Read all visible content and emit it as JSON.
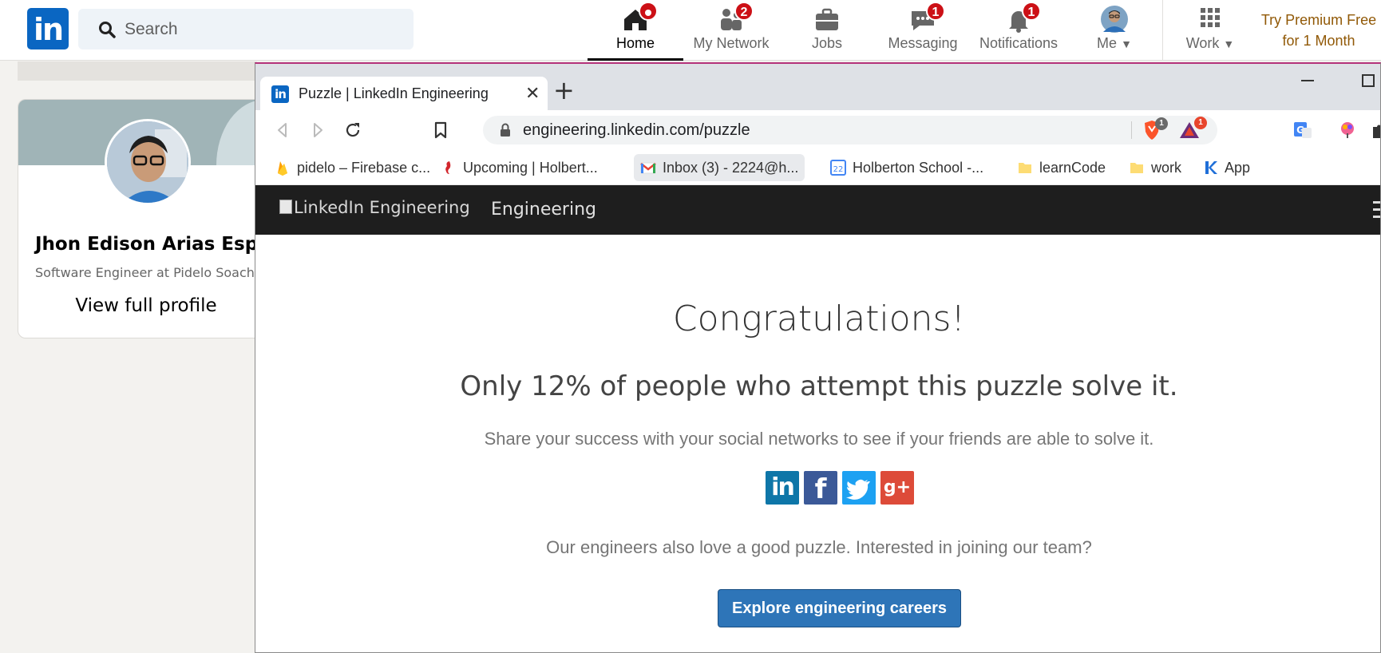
{
  "linkedin": {
    "logo_text": "in",
    "search_placeholder": "Search",
    "nav": [
      {
        "label": "Home",
        "badge": ""
      },
      {
        "label": "My Network",
        "badge": "2"
      },
      {
        "label": "Jobs",
        "badge": ""
      },
      {
        "label": "Messaging",
        "badge": "1"
      },
      {
        "label": "Notifications",
        "badge": "1"
      },
      {
        "label": "Me",
        "badge": ""
      },
      {
        "label": "Work",
        "badge": ""
      }
    ],
    "premium_line1": "Try Premium Free",
    "premium_line2": "for 1 Month",
    "brand_color": "#0a66c2",
    "badge_color": "#cc1016"
  },
  "profile": {
    "name": "Jhon Edison Arias Esparza",
    "headline": "Software Engineer at Pidelo Soacha",
    "link": "View full profile"
  },
  "browser": {
    "tab_title": "Puzzle | LinkedIn Engineering",
    "tab_favicon": "in",
    "url": "engineering.linkedin.com/puzzle",
    "extension_badges": [
      "1",
      "1"
    ],
    "bookmarks": [
      {
        "label": "pidelo – Firebase c...",
        "icon": "firebase-icon"
      },
      {
        "label": "Upcoming | Holbert...",
        "icon": "seahorse-icon"
      },
      {
        "label": "Inbox (3) - 2224@h...",
        "icon": "gmail-icon"
      },
      {
        "label": "Holberton School -...",
        "icon": "calendar-icon",
        "calendar_day": "22"
      },
      {
        "label": "learnCode",
        "icon": "folder-icon"
      },
      {
        "label": "work",
        "icon": "folder-icon"
      },
      {
        "label": "App",
        "icon": "k-icon"
      }
    ]
  },
  "page": {
    "header_img_alt": "LinkedIn Engineering",
    "header_text": "Engineering",
    "congrats": "Congratulations!",
    "stat": "Only 12% of people who attempt this puzzle solve it.",
    "share_text": "Share your success with your social networks to see if your friends are able to solve it.",
    "socials": [
      {
        "name": "linkedin",
        "glyph": "in",
        "color": "#0e76a8"
      },
      {
        "name": "facebook",
        "glyph": "f",
        "color": "#3b5998"
      },
      {
        "name": "twitter",
        "glyph": "",
        "color": "#1da1f2"
      },
      {
        "name": "google-plus",
        "glyph": "g+",
        "color": "#dd4b39"
      }
    ],
    "careers_text": "Our engineers also love a good puzzle. Interested in joining our team?",
    "cta_label": "Explore engineering careers"
  }
}
